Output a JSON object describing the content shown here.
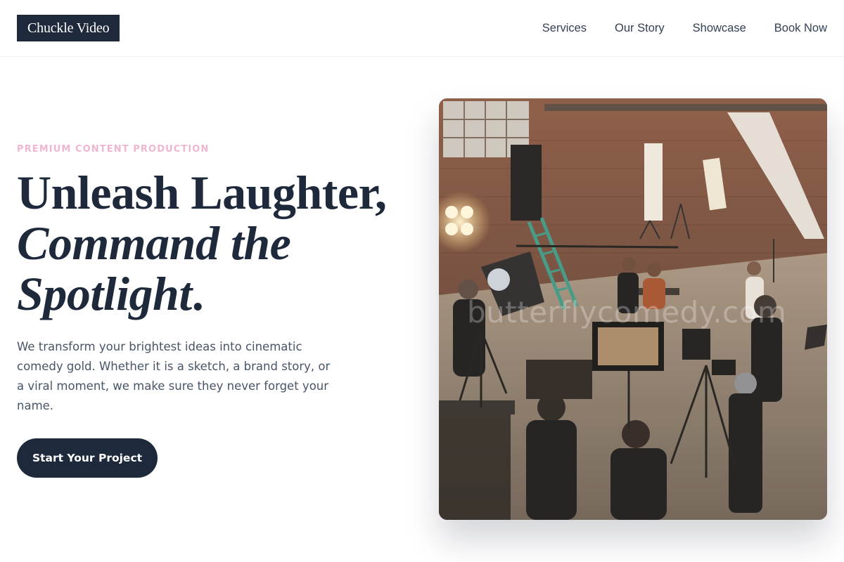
{
  "header": {
    "logo": "Chuckle Video",
    "nav": [
      {
        "label": "Services"
      },
      {
        "label": "Our Story"
      },
      {
        "label": "Showcase"
      },
      {
        "label": "Book Now"
      }
    ]
  },
  "hero": {
    "eyebrow": "PREMIUM CONTENT PRODUCTION",
    "headline_line1": "Unleash Laughter,",
    "headline_line2": "Command the",
    "headline_line3_italic": "Spotlight",
    "headline_line3_end": ".",
    "lead": "We transform your brightest ideas into cinematic comedy gold. Whether it is a sketch, a brand story, or a viral moment, we make sure they never forget your name.",
    "cta_label": "Start Your Project",
    "image_watermark": "butterflycomedy.com"
  },
  "colors": {
    "primary": "#1e293b",
    "accent_pink": "#f0b6cf",
    "body_text": "#475569"
  }
}
